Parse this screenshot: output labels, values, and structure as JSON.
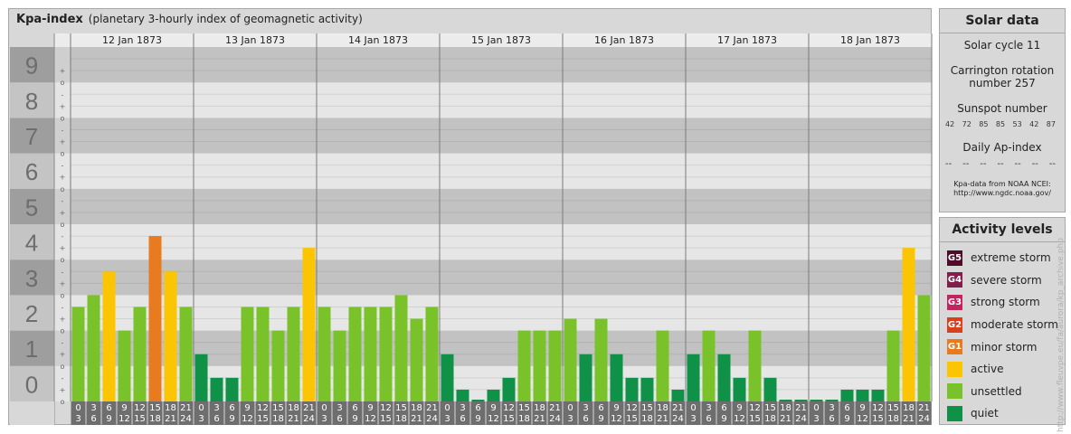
{
  "header": {
    "title": "Kpa-index",
    "subtitle": "(planetary 3-hourly index of geomagnetic activity)"
  },
  "chart_data": {
    "type": "bar",
    "y_ticks": [
      "0",
      "1",
      "2",
      "3",
      "4",
      "5",
      "6",
      "7",
      "8",
      "9"
    ],
    "ylim": [
      0,
      9
    ],
    "subticks": [
      "-",
      "o",
      "+"
    ],
    "days": [
      "12 Jan 1873",
      "13 Jan 1873",
      "14 Jan 1873",
      "15 Jan 1873",
      "16 Jan 1873",
      "17 Jan 1873",
      "18 Jan 1873"
    ],
    "interval_start": [
      "0",
      "3",
      "6",
      "9",
      "12",
      "15",
      "18",
      "21"
    ],
    "interval_end": [
      "3",
      "6",
      "9",
      "12",
      "15",
      "18",
      "21",
      "24"
    ],
    "values": [
      [
        2.667,
        3.0,
        3.667,
        2.0,
        2.667,
        4.667,
        3.667,
        2.667
      ],
      [
        1.333,
        0.667,
        0.667,
        2.667,
        2.667,
        2.0,
        2.667,
        4.333
      ],
      [
        2.667,
        2.0,
        2.667,
        2.667,
        2.667,
        3.0,
        2.333,
        2.667
      ],
      [
        1.333,
        0.333,
        0.0,
        0.333,
        0.667,
        2.0,
        2.0,
        2.0
      ],
      [
        2.333,
        1.333,
        2.333,
        1.333,
        0.667,
        0.667,
        2.0,
        0.333
      ],
      [
        1.333,
        2.0,
        1.333,
        0.667,
        2.0,
        0.667,
        0.0,
        0.0
      ],
      [
        0.0,
        0.0,
        0.333,
        0.333,
        0.333,
        2.0,
        4.333,
        3.0
      ]
    ],
    "colors": {
      "quiet": "#0f9147",
      "unsettled": "#7ac22a",
      "active": "#fbc503",
      "minor": "#e87b20",
      "moderate": "#d8401d",
      "strong": "#c0255f",
      "severe": "#851c4e",
      "extreme": "#4f0d2a"
    },
    "grid": true,
    "legend": "right"
  },
  "solar": {
    "title": "Solar data",
    "cycle": "Solar cycle 11",
    "carrington1": "Carrington rotation",
    "carrington2": "number 257",
    "sunspot_label": "Sunspot number",
    "sunspots": [
      "42",
      "72",
      "85",
      "85",
      "53",
      "42",
      "87"
    ],
    "ap_label": "Daily Ap-index",
    "ap_values": [
      "--",
      "--",
      "--",
      "--",
      "--",
      "--",
      "--"
    ],
    "source1": "Kpa-data from NOAA NCEI:",
    "source2": "http://www.ngdc.noaa.gov/"
  },
  "levels": {
    "title": "Activity levels",
    "items": [
      {
        "code": "G5",
        "label": "extreme storm",
        "color": "#4f0d2a"
      },
      {
        "code": "G4",
        "label": "severe storm",
        "color": "#851c4e"
      },
      {
        "code": "G3",
        "label": "strong storm",
        "color": "#c0255f"
      },
      {
        "code": "G2",
        "label": "moderate storm",
        "color": "#d8401d"
      },
      {
        "code": "G1",
        "label": "minor storm",
        "color": "#e87b20"
      },
      {
        "code": "",
        "label": "active",
        "color": "#fbc503"
      },
      {
        "code": "",
        "label": "unsettled",
        "color": "#7ac22a"
      },
      {
        "code": "",
        "label": "quiet",
        "color": "#0f9147"
      }
    ]
  },
  "watermark": "http://www.fleuvpe.eu/fa/aurora/kp_archive.php"
}
